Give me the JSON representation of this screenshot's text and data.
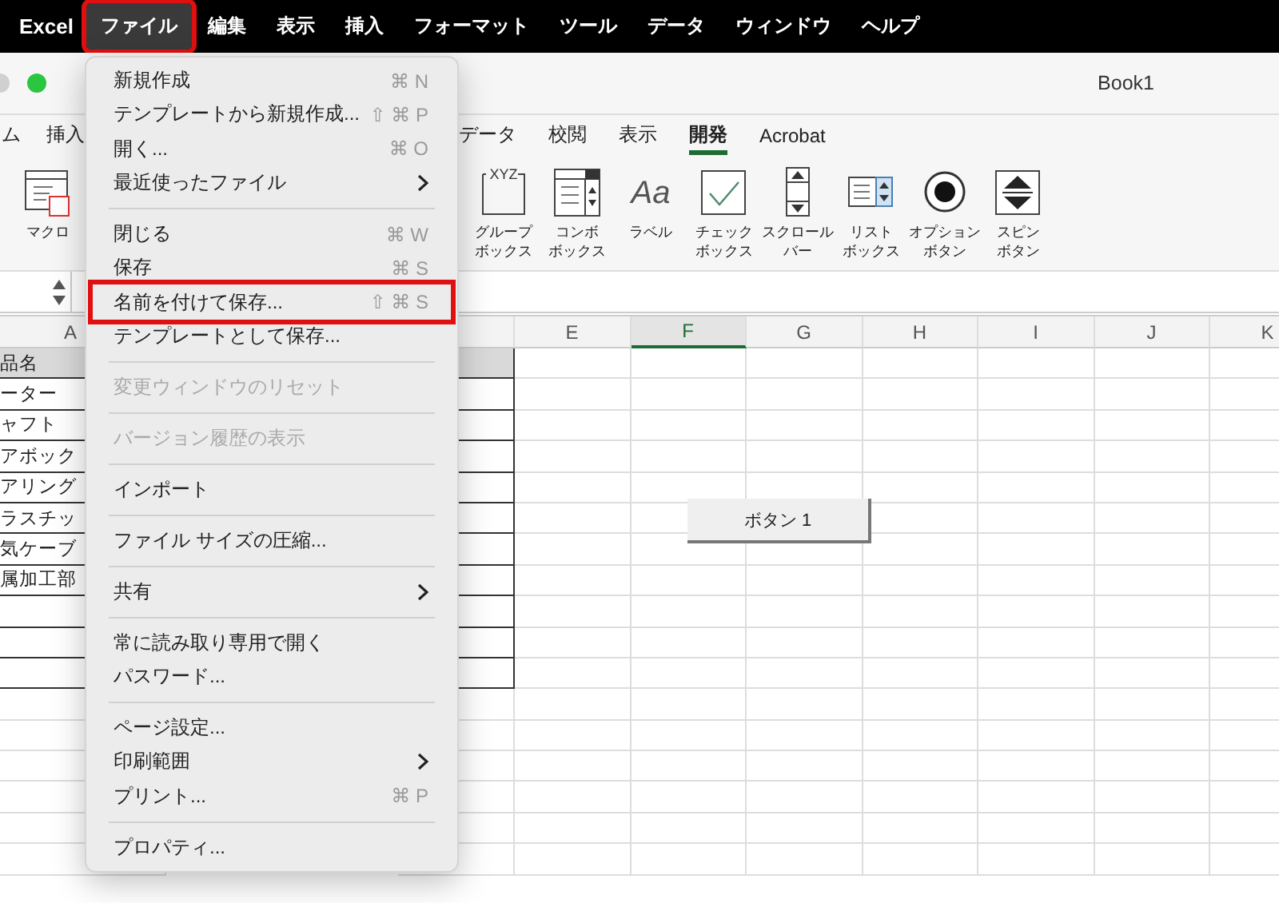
{
  "menubar": {
    "app": "Excel",
    "items": [
      {
        "label": "ファイル",
        "selected": true,
        "highlighted": true
      },
      {
        "label": "編集",
        "selected": false,
        "highlighted": false
      },
      {
        "label": "表示",
        "selected": false,
        "highlighted": false
      },
      {
        "label": "挿入",
        "selected": false,
        "highlighted": false
      },
      {
        "label": "フォーマット",
        "selected": false,
        "highlighted": false
      },
      {
        "label": "ツール",
        "selected": false,
        "highlighted": false
      },
      {
        "label": "データ",
        "selected": false,
        "highlighted": false
      },
      {
        "label": "ウィンドウ",
        "selected": false,
        "highlighted": false
      },
      {
        "label": "ヘルプ",
        "selected": false,
        "highlighted": false
      }
    ]
  },
  "window": {
    "title": "Book1"
  },
  "ribbon": {
    "tabs_left": [
      {
        "label": "ム",
        "selected": false
      },
      {
        "label": "挿入",
        "selected": false
      }
    ],
    "tabs_right": [
      {
        "label": "データ",
        "selected": false
      },
      {
        "label": "校閲",
        "selected": false
      },
      {
        "label": "表示",
        "selected": false
      },
      {
        "label": "開発",
        "selected": true
      },
      {
        "label": "Acrobat",
        "selected": false
      }
    ],
    "controls_left": [
      {
        "kind": "macro",
        "label": "マクロ"
      }
    ],
    "controls_right": [
      {
        "kind": "groupbox",
        "icon_text": "XYZ",
        "label_lines": [
          "グループ",
          "ボックス"
        ]
      },
      {
        "kind": "combobox",
        "label_lines": [
          "コンボ",
          "ボックス"
        ]
      },
      {
        "kind": "label",
        "icon_text": "Aa",
        "label_lines": [
          "ラベル"
        ]
      },
      {
        "kind": "checkbox",
        "label_lines": [
          "チェック",
          "ボックス"
        ]
      },
      {
        "kind": "scrollbar",
        "label_lines": [
          "スクロール",
          "バー"
        ]
      },
      {
        "kind": "listbox",
        "label_lines": [
          "リスト",
          "ボックス"
        ]
      },
      {
        "kind": "option",
        "label_lines": [
          "オプション",
          "ボタン"
        ]
      },
      {
        "kind": "spin",
        "label_lines": [
          "スピン",
          "ボタン"
        ]
      }
    ]
  },
  "sheet": {
    "columns": [
      {
        "label": "A",
        "selected": false
      },
      {
        "label": "E",
        "selected": false
      },
      {
        "label": "F",
        "selected": true
      },
      {
        "label": "G",
        "selected": false
      },
      {
        "label": "H",
        "selected": false
      },
      {
        "label": "I",
        "selected": false
      },
      {
        "label": "J",
        "selected": false
      },
      {
        "label": "K",
        "selected": false
      }
    ],
    "table_rows": [
      {
        "kind": "header",
        "text": "品名"
      },
      {
        "kind": "data",
        "text": "ーター"
      },
      {
        "kind": "data",
        "text": "ャフト"
      },
      {
        "kind": "data",
        "text": "アボック"
      },
      {
        "kind": "data",
        "text": "アリング"
      },
      {
        "kind": "data",
        "text": "ラスチッ"
      },
      {
        "kind": "data",
        "text": "気ケーブ"
      },
      {
        "kind": "data",
        "text": "属加工部"
      },
      {
        "kind": "data"
      },
      {
        "kind": "data"
      },
      {
        "kind": "data"
      }
    ],
    "form_button": {
      "label": "ボタン 1"
    }
  },
  "file_menu": {
    "items": [
      {
        "kind": "item",
        "label": "新規作成",
        "shortcut": "⌘ N",
        "submenu": false,
        "disabled": false,
        "highlighted": false
      },
      {
        "kind": "item",
        "label": "テンプレートから新規作成...",
        "shortcut": "⇧ ⌘ P",
        "submenu": false,
        "disabled": false,
        "highlighted": false
      },
      {
        "kind": "item",
        "label": "開く...",
        "shortcut": "⌘ O",
        "submenu": false,
        "disabled": false,
        "highlighted": false
      },
      {
        "kind": "item",
        "label": "最近使ったファイル",
        "submenu": true,
        "disabled": false,
        "highlighted": false
      },
      {
        "kind": "separator"
      },
      {
        "kind": "item",
        "label": "閉じる",
        "shortcut": "⌘ W",
        "submenu": false,
        "disabled": false,
        "highlighted": false
      },
      {
        "kind": "item",
        "label": "保存",
        "shortcut": "⌘ S",
        "submenu": false,
        "disabled": false,
        "highlighted": false
      },
      {
        "kind": "item",
        "label": "名前を付けて保存...",
        "shortcut": "⇧ ⌘ S",
        "submenu": false,
        "disabled": false,
        "highlighted": true
      },
      {
        "kind": "item",
        "label": "テンプレートとして保存...",
        "submenu": false,
        "disabled": false,
        "highlighted": false
      },
      {
        "kind": "separator"
      },
      {
        "kind": "item",
        "label": "変更ウィンドウのリセット",
        "submenu": false,
        "disabled": true,
        "highlighted": false
      },
      {
        "kind": "separator"
      },
      {
        "kind": "item",
        "label": "バージョン履歴の表示",
        "submenu": false,
        "disabled": true,
        "highlighted": false
      },
      {
        "kind": "separator"
      },
      {
        "kind": "item",
        "label": "インポート",
        "submenu": false,
        "disabled": false,
        "highlighted": false
      },
      {
        "kind": "separator"
      },
      {
        "kind": "item",
        "label": "ファイル サイズの圧縮...",
        "submenu": false,
        "disabled": false,
        "highlighted": false
      },
      {
        "kind": "separator"
      },
      {
        "kind": "item",
        "label": "共有",
        "submenu": true,
        "disabled": false,
        "highlighted": false
      },
      {
        "kind": "separator"
      },
      {
        "kind": "item",
        "label": "常に読み取り専用で開く",
        "submenu": false,
        "disabled": false,
        "highlighted": false
      },
      {
        "kind": "item",
        "label": "パスワード...",
        "submenu": false,
        "disabled": false,
        "highlighted": false
      },
      {
        "kind": "separator"
      },
      {
        "kind": "item",
        "label": "ページ設定...",
        "submenu": false,
        "disabled": false,
        "highlighted": false
      },
      {
        "kind": "item",
        "label": "印刷範囲",
        "submenu": true,
        "disabled": false,
        "highlighted": false
      },
      {
        "kind": "item",
        "label": "プリント...",
        "shortcut": "⌘ P",
        "submenu": false,
        "disabled": false,
        "highlighted": false
      },
      {
        "kind": "separator"
      },
      {
        "kind": "item",
        "label": "プロパティ...",
        "submenu": false,
        "disabled": false,
        "highlighted": false
      }
    ]
  }
}
